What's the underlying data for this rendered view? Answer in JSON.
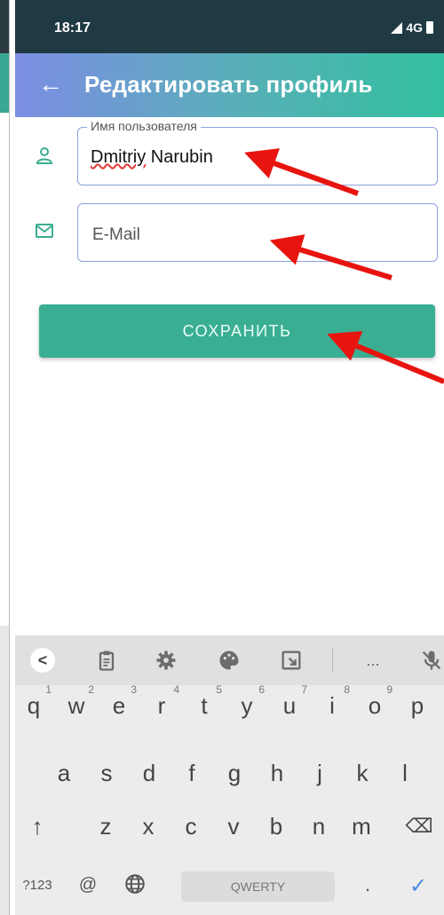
{
  "status": {
    "time": "18:17",
    "network": "4G"
  },
  "appbar": {
    "back_icon": "←",
    "title": "Редактировать профиль"
  },
  "form": {
    "username": {
      "label": "Имя пользователя",
      "value_first": "Dmitriy",
      "value_rest": " Narubin"
    },
    "email": {
      "placeholder": "E-Mail"
    }
  },
  "save_button": {
    "label": "СОХРАНИТЬ"
  },
  "keyboard": {
    "toolbar": [
      "<",
      "clipboard",
      "settings",
      "palette",
      "screen",
      "...",
      "mic-off"
    ],
    "row1": [
      [
        "q",
        "1"
      ],
      [
        "w",
        "2"
      ],
      [
        "e",
        "3"
      ],
      [
        "r",
        "4"
      ],
      [
        "t",
        "5"
      ],
      [
        "y",
        "6"
      ],
      [
        "u",
        "7"
      ],
      [
        "i",
        "8"
      ],
      [
        "o",
        "9"
      ],
      [
        "p",
        ""
      ]
    ],
    "row2": [
      "a",
      "s",
      "d",
      "f",
      "g",
      "h",
      "j",
      "k",
      "l"
    ],
    "row3": [
      "z",
      "x",
      "c",
      "v",
      "b",
      "n",
      "m"
    ],
    "shift": "↑",
    "backspace": "⌫",
    "symbols": "?123",
    "at": "@",
    "space_label": "QWERTY",
    "period": ".",
    "enter": "✓"
  },
  "colors": {
    "accent": "#3aae92",
    "status_bar": "#203a44",
    "field_border": "#8da1dd",
    "arrow": "#e8140f"
  }
}
